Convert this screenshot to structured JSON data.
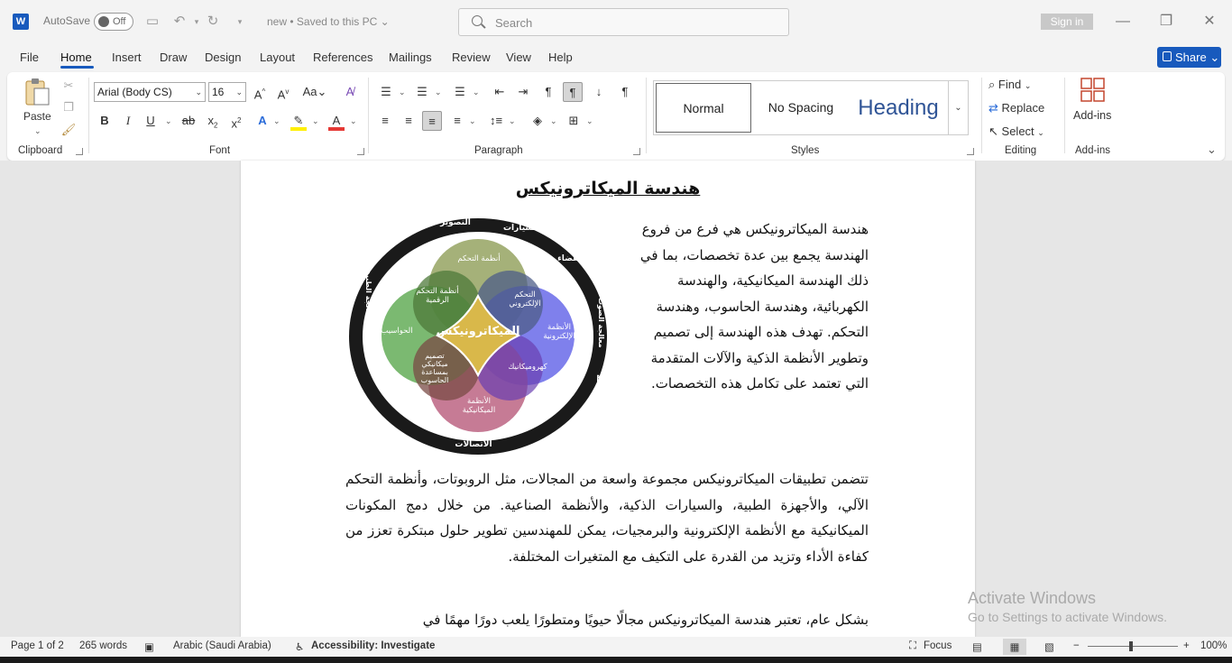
{
  "titlebar": {
    "app_letter": "W",
    "autosave_label": "AutoSave",
    "autosave_state": "Off",
    "doc_name": "new",
    "doc_status": "Saved to this PC",
    "search_placeholder": "Search",
    "signin_label": "Sign in"
  },
  "menu": {
    "tabs": [
      "File",
      "Home",
      "Insert",
      "Draw",
      "Design",
      "Layout",
      "References",
      "Mailings",
      "Review",
      "View",
      "Help"
    ],
    "active_tab": "Home",
    "share_label": "Share"
  },
  "ribbon": {
    "clipboard": {
      "paste_label": "Paste",
      "group_label": "Clipboard"
    },
    "font": {
      "font_name": "Arial (Body CS)",
      "font_size": "16",
      "group_label": "Font"
    },
    "paragraph": {
      "group_label": "Paragraph"
    },
    "styles": {
      "items": [
        "Normal",
        "No Spacing",
        "Heading"
      ],
      "group_label": "Styles"
    },
    "editing": {
      "find_label": "Find",
      "replace_label": "Replace",
      "select_label": "Select",
      "group_label": "Editing"
    },
    "addins": {
      "addins_label": "Add-ins",
      "group_label": "Add-ins"
    }
  },
  "document": {
    "heading": "هندسة الميكاترونيكس",
    "para1": "هندسة الميكاترونيكس هي فرع من فروع الهندسة يجمع بين عدة تخصصات، بما في ذلك الهندسة الميكانيكية، والهندسة الكهربائية، وهندسة الحاسوب، وهندسة التحكم. تهدف هذه الهندسة إلى تصميم وتطوير الأنظمة الذكية والآلات المتقدمة التي تعتمد على تكامل هذه التخصصات.",
    "para2": "تتضمن تطبيقات الميكاترونيكس مجموعة واسعة من المجالات، مثل الروبوتات، وأنظمة التحكم الآلي، والأجهزة الطبية، والسيارات الذكية، والأنظمة الصناعية. من خلال دمج المكونات الميكانيكية مع الأنظمة الإلكترونية والبرمجيات، يمكن للمهندسين تطوير حلول مبتكرة تعزز من كفاءة الأداء وتزيد من القدرة على التكيف مع المتغيرات المختلفة.",
    "para3": "بشكل عام، تعتبر هندسة الميكاترونيكس مجالًا حيويًا ومتطورًا يلعب دورًا مهمًا في",
    "diagram": {
      "center": "الميكاترونيكس",
      "ring_labels": [
        "التصوير",
        "السيارات",
        "الفضاء",
        "معالجة الصوت",
        "الطاقة",
        "الاتصالات",
        "المعالجة الطبية"
      ],
      "petals": [
        "أنظمة التحكم",
        "التحكم الإلكتروني",
        "الأنظمة الإلكترونية",
        "كهروميكانيك",
        "الأنظمة الميكانيكية",
        "تصميم ميكانيكي بمساعدة الحاسوب",
        "الحواسيب",
        "أنظمة التحكم الرقمية"
      ]
    }
  },
  "watermark": {
    "line1": "Activate Windows",
    "line2": "Go to Settings to activate Windows."
  },
  "statusbar": {
    "page": "Page 1 of 2",
    "words": "265 words",
    "language": "Arabic (Saudi Arabia)",
    "accessibility": "Accessibility: Investigate",
    "focus": "Focus",
    "zoom": "100%"
  }
}
